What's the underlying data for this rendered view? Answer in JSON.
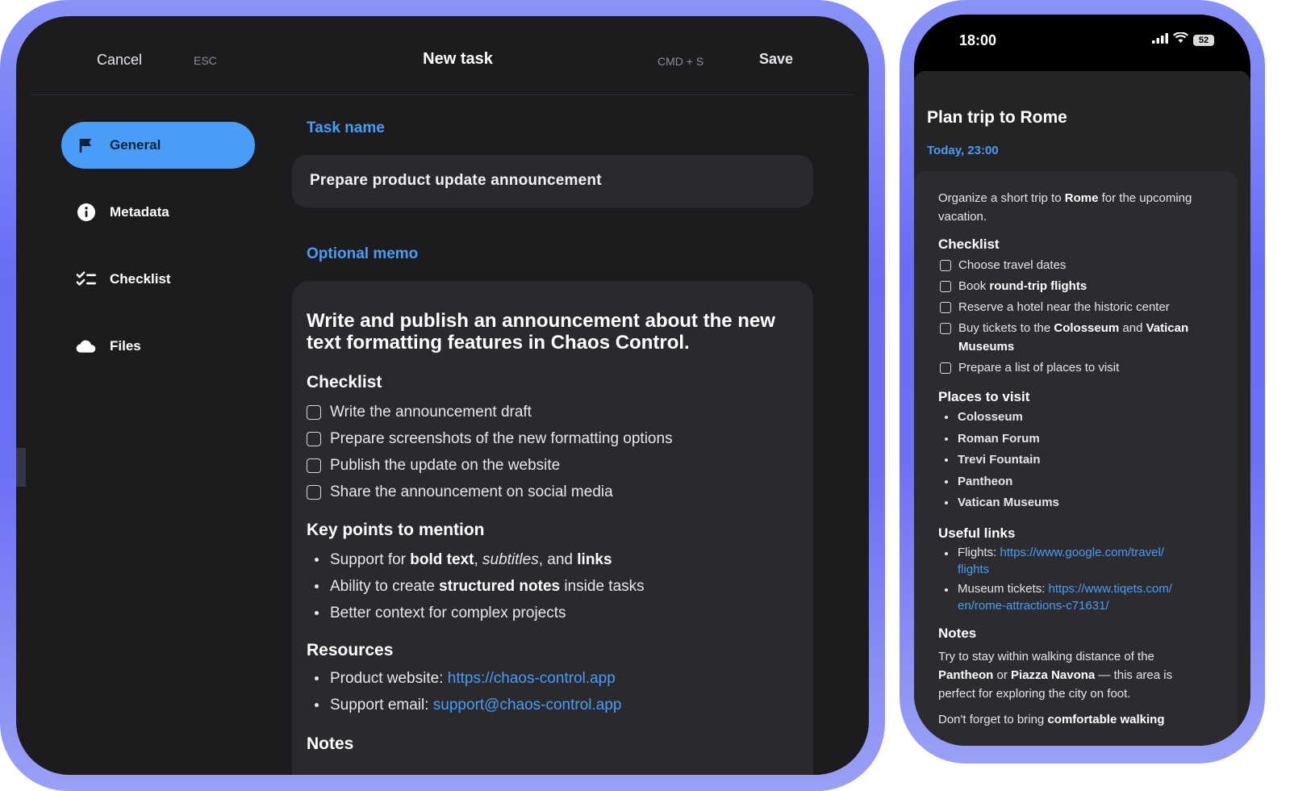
{
  "tablet": {
    "header": {
      "cancel": "Cancel",
      "cancel_shortcut": "ESC",
      "title": "New task",
      "save_shortcut": "CMD + S",
      "save": "Save"
    },
    "sidebar": {
      "items": [
        {
          "label": "General",
          "icon": "flag-icon",
          "active": true
        },
        {
          "label": "Metadata",
          "icon": "info-icon"
        },
        {
          "label": "Checklist",
          "icon": "checklist-icon"
        },
        {
          "label": "Files",
          "icon": "cloud-icon"
        }
      ]
    },
    "task_name": {
      "label": "Task name",
      "value": "Prepare product update announcement"
    },
    "memo": {
      "label": "Optional memo",
      "heading": "Write and publish an announcement about the new text formatting features in Chaos Control.",
      "checklist_title": "Checklist",
      "checklist": [
        "Write the announcement draft",
        "Prepare screenshots of the new formatting options",
        "Publish the update on the website",
        "Share the announcement on social media"
      ],
      "key_points_title": "Key points to mention",
      "key_points": {
        "p1": {
          "pre": "Support for ",
          "bold1": "bold text",
          "sep1": ", ",
          "italic": "subtitles",
          "sep2": ", and ",
          "bold2": "links"
        },
        "p2": {
          "pre": "Ability to create ",
          "bold": "structured notes",
          "post": " inside tasks"
        },
        "p3": "Better context for complex projects"
      },
      "resources_title": "Resources",
      "resources": [
        {
          "label": "Product website: ",
          "link": "https://chaos-control.app"
        },
        {
          "label": "Support email: ",
          "link": "support@chaos-control.app"
        }
      ],
      "notes_title": "Notes"
    }
  },
  "phone": {
    "status": {
      "time": "18:00",
      "battery": "52"
    },
    "title": "Plan trip to Rome",
    "date": "Today, 23:00",
    "intro": {
      "pre": "Organize a short trip to ",
      "bold": "Rome",
      "post": " for the upcoming vacation."
    },
    "checklist_title": "Checklist",
    "checklist": {
      "c1": "Choose travel dates",
      "c2": {
        "pre": "Book ",
        "bold": "round-trip flights"
      },
      "c3": "Reserve a hotel near the historic center",
      "c4": {
        "pre": "Buy tickets to the ",
        "bold1": "Colosseum",
        "mid": " and ",
        "bold2": "Vatican Museums"
      },
      "c5": "Prepare a list of places to visit"
    },
    "places_title": "Places to visit",
    "places": [
      "Colosseum",
      "Roman Forum",
      "Trevi Fountain",
      "Pantheon",
      "Vatican Museums"
    ],
    "links_title": "Useful links",
    "links": [
      {
        "label": "Flights: ",
        "link1": "https://www.google.com/travel/",
        "link2": "flights"
      },
      {
        "label": "Museum tickets: ",
        "link1": "https://www.tiqets.com/",
        "link2": "en/rome-attractions-c71631/"
      }
    ],
    "notes_title": "Notes",
    "notes": {
      "pre": "Try to stay within walking distance of the ",
      "bold1": "Pantheon",
      "mid": " or ",
      "bold2": "Piazza Navona",
      "post": " — this area is perfect for exploring the city on foot.",
      "next_pre": "Don't forget to bring ",
      "next_bold": "comfortable walking"
    }
  },
  "colors": {
    "accent": "#4b9cf6",
    "frame": "#6a6cf5",
    "surface": "#2a2a2e",
    "background": "#1c1c1f"
  }
}
